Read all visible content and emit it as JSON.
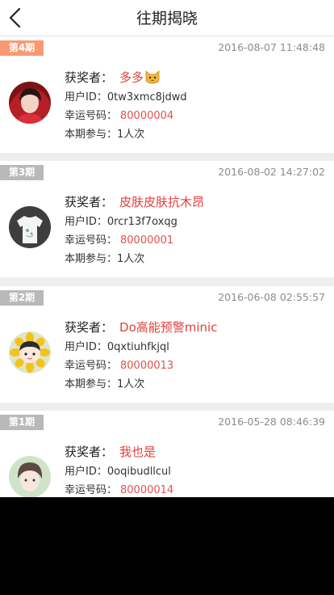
{
  "header": {
    "title": "往期揭晓"
  },
  "labels": {
    "winner": "获奖者：",
    "user_id": "用户ID：",
    "lucky": "幸运号码：",
    "participation": "本期参与："
  },
  "records": [
    {
      "period": "第4期",
      "time": "2016-08-07 11:48:48",
      "winner": "多多",
      "user_id": "0tw3xmc8jdwd",
      "lucky_number": "80000004",
      "participation": "1人次"
    },
    {
      "period": "第3期",
      "time": "2016-08-02 14:27:02",
      "winner": "皮肤皮肤抗木昂",
      "user_id": "0rcr13f7oxqg",
      "lucky_number": "80000001",
      "participation": "1人次"
    },
    {
      "period": "第2期",
      "time": "2016-06-08 02:55:57",
      "winner": "Do高能预警minic",
      "user_id": "0qxtiuhfkjql",
      "lucky_number": "80000013",
      "participation": "1人次"
    },
    {
      "period": "第1期",
      "time": "2016-05-28 08:46:39",
      "winner": "我也是",
      "user_id": "0oqibudllcul",
      "lucky_number": "80000014"
    }
  ],
  "colors": {
    "accent": "#e0413c",
    "tag_current": "#f79a74",
    "tag_past": "#b9b9b9"
  }
}
